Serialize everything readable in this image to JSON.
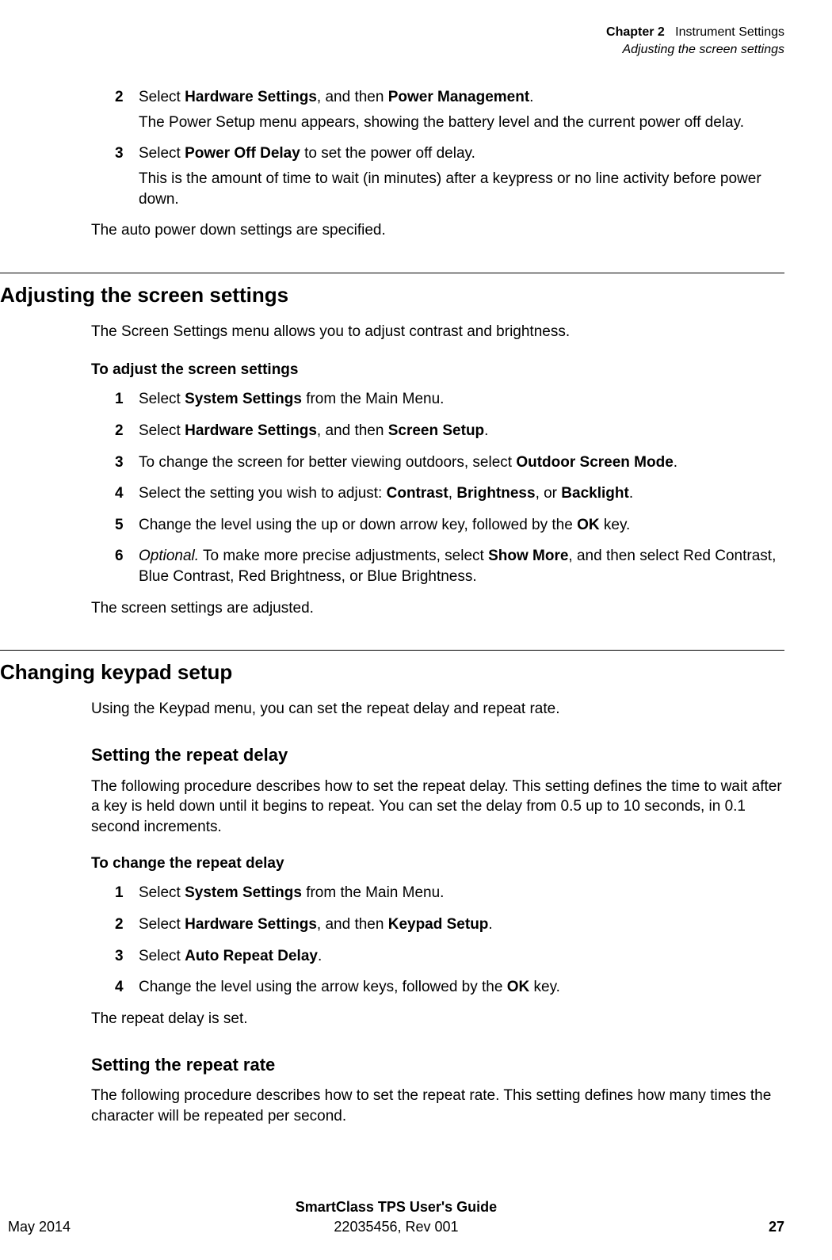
{
  "header": {
    "chapter_label": "Chapter 2",
    "chapter_title": "Instrument Settings",
    "section_title": "Adjusting the screen settings"
  },
  "power": {
    "step2_num": "2",
    "step2_a": "Select ",
    "step2_b1": "Hardware Settings",
    "step2_c": ", and then ",
    "step2_b2": "Power Management",
    "step2_d": ".",
    "step2_sub": "The Power Setup menu appears, showing the battery level and the current power off delay.",
    "step3_num": "3",
    "step3_a": "Select ",
    "step3_b": "Power Off Delay",
    "step3_c": " to set the power off delay.",
    "step3_sub": "This is the amount of time to wait (in minutes) after a keypress or no line activity before power down.",
    "result": "The auto power down settings are specified."
  },
  "screen": {
    "heading": "Adjusting the screen settings",
    "intro": "The Screen Settings menu allows you to adjust contrast and brightness.",
    "task": "To adjust the screen settings",
    "s1_num": "1",
    "s1_a": "Select ",
    "s1_b": "System Settings",
    "s1_c": " from the Main Menu.",
    "s2_num": "2",
    "s2_a": "Select ",
    "s2_b1": "Hardware Settings",
    "s2_c": ", and then ",
    "s2_b2": "Screen Setup",
    "s2_d": ".",
    "s3_num": "3",
    "s3_a": "To change the screen for better viewing outdoors, select ",
    "s3_b": "Outdoor Screen Mode",
    "s3_c": ".",
    "s4_num": "4",
    "s4_a": "Select the setting you wish to adjust: ",
    "s4_b1": "Contrast",
    "s4_c1": ", ",
    "s4_b2": "Brightness",
    "s4_c2": ", or ",
    "s4_b3": "Backlight",
    "s4_c3": ".",
    "s5_num": "5",
    "s5_a": "Change the level using the up or down arrow key, followed by the ",
    "s5_b": "OK",
    "s5_c": " key.",
    "s6_num": "6",
    "s6_a": "Optional.",
    "s6_b": " To make more precise adjustments, select ",
    "s6_c": "Show More",
    "s6_d": ", and then select Red Contrast, Blue Contrast, Red Brightness, or Blue Brightness.",
    "result": "The screen settings are adjusted."
  },
  "keypad": {
    "heading": "Changing keypad setup",
    "intro": "Using the Keypad menu, you can set the repeat delay and repeat rate.",
    "sub1_heading": "Setting the repeat delay",
    "sub1_intro": "The following procedure describes how to set the repeat delay. This setting defines the time to wait after a key is held down until it begins to repeat. You can set the delay from 0.5 up to 10 seconds, in 0.1 second increments.",
    "sub1_task": "To change the repeat delay",
    "s1_num": "1",
    "s1_a": "Select ",
    "s1_b": "System Settings",
    "s1_c": " from the Main Menu.",
    "s2_num": "2",
    "s2_a": "Select ",
    "s2_b1": "Hardware Settings",
    "s2_c": ", and then ",
    "s2_b2": "Keypad Setup",
    "s2_d": ".",
    "s3_num": "3",
    "s3_a": "Select ",
    "s3_b": "Auto Repeat Delay",
    "s3_c": ".",
    "s4_num": "4",
    "s4_a": "Change the level using the arrow keys, followed by the ",
    "s4_b": "OK",
    "s4_c": " key.",
    "sub1_result": "The repeat delay is set.",
    "sub2_heading": "Setting the repeat rate",
    "sub2_intro": "The following procedure describes how to set the repeat rate. This setting defines how many times the character will be repeated per second."
  },
  "footer": {
    "title": "SmartClass TPS User's Guide",
    "docnum": "22035456, Rev 001",
    "date": "May 2014",
    "page": "27"
  }
}
